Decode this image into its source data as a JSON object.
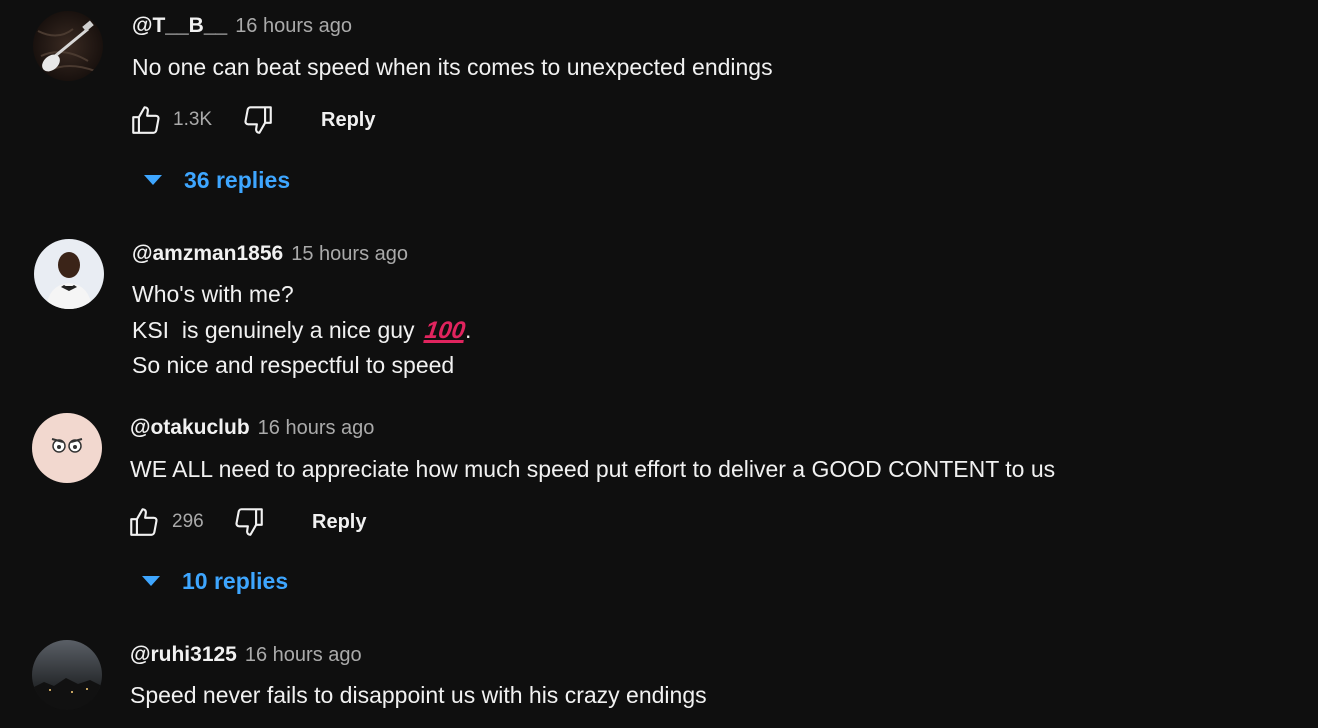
{
  "comments": [
    {
      "author": "@T__B__",
      "time": "16 hours ago",
      "text": "No one can beat speed when its comes to unexpected endings",
      "likes": "1.3K",
      "reply_label": "Reply",
      "replies": "36 replies"
    },
    {
      "author": "@amzman1856",
      "time": "15 hours ago",
      "line1": "Who's with me?",
      "line2_pre": "KSI  is genuinely a nice guy",
      "line2_emoji": "💯",
      "line2_post": ".",
      "line3": "So nice and respectful to speed"
    },
    {
      "author": "@otakuclub",
      "time": "16 hours ago",
      "text": "WE ALL need to appreciate how much speed put effort to deliver a GOOD CONTENT to us",
      "likes": "296",
      "reply_label": "Reply",
      "replies": "10 replies"
    },
    {
      "author": "@ruhi3125",
      "time": "16 hours ago",
      "text": "Speed never fails to disappoint us with his crazy endings"
    }
  ],
  "colors": {
    "background": "#0f0f0f",
    "text": "#f1f1f1",
    "secondary": "#aaaaaa",
    "link": "#3ea6ff"
  },
  "icons": {
    "like": "thumbs-up-icon",
    "dislike": "thumbs-down-icon",
    "expand": "caret-down-icon"
  }
}
